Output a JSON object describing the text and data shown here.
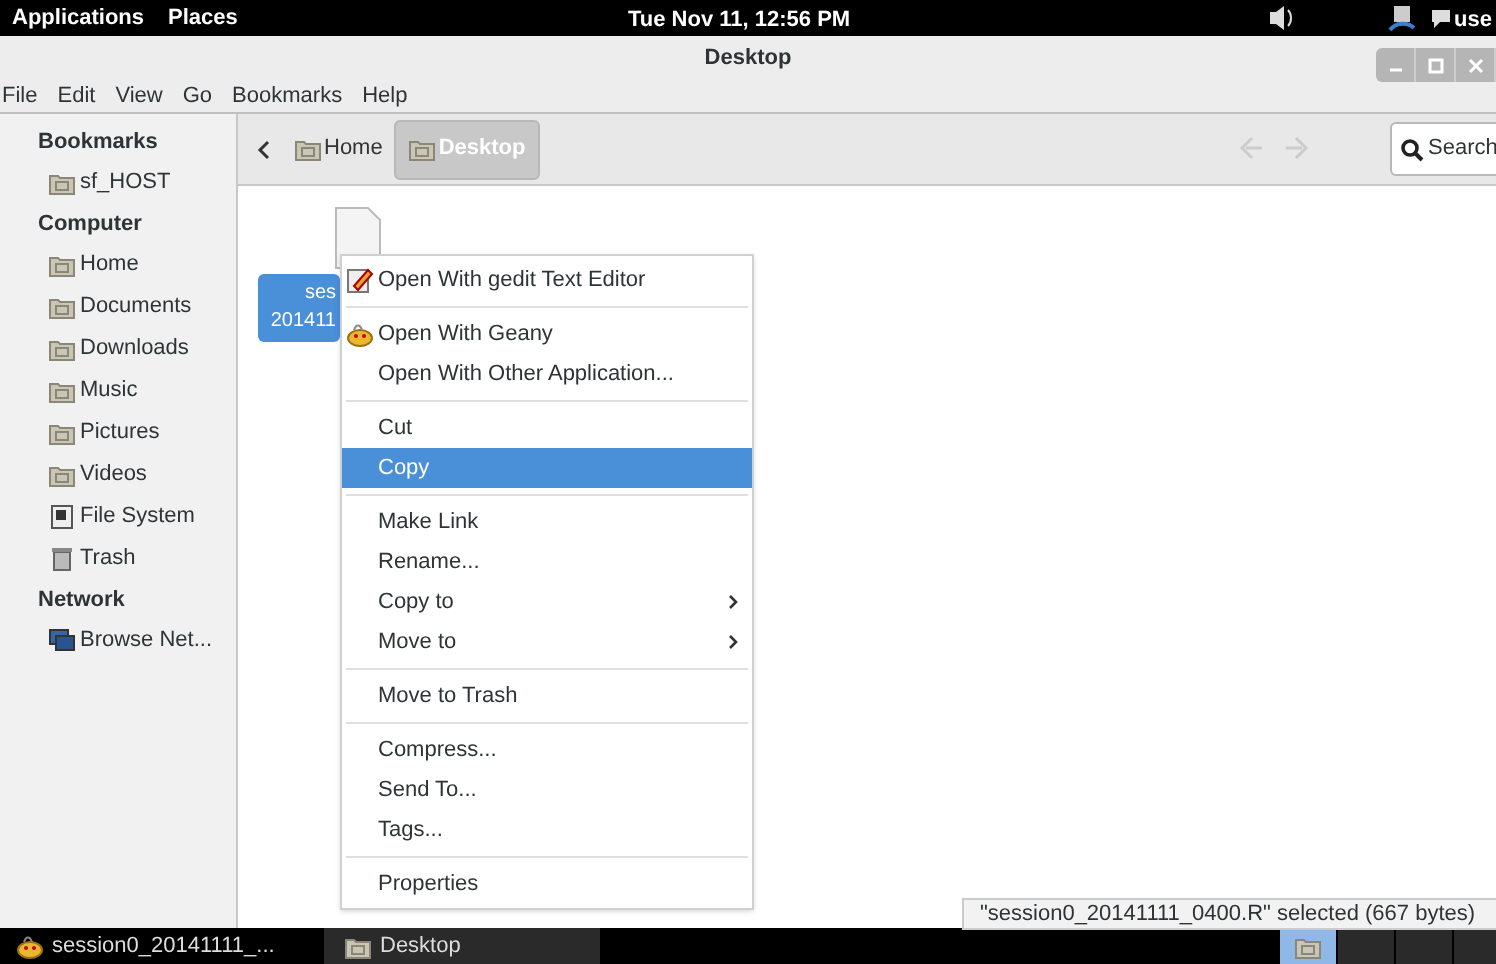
{
  "top_bar": {
    "menus": [
      "Applications",
      "Places"
    ],
    "clock": "Tue Nov 11, 12:56 PM",
    "user": "use"
  },
  "window": {
    "title": "Desktop"
  },
  "menu_bar": [
    "File",
    "Edit",
    "View",
    "Go",
    "Bookmarks",
    "Help"
  ],
  "sidebar": [
    {
      "heading": "Bookmarks",
      "items": [
        {
          "label": "sf_HOST",
          "kind": "folder"
        }
      ]
    },
    {
      "heading": "Computer",
      "items": [
        {
          "label": "Home",
          "kind": "folder"
        },
        {
          "label": "Documents",
          "kind": "folder"
        },
        {
          "label": "Downloads",
          "kind": "folder"
        },
        {
          "label": "Music",
          "kind": "folder"
        },
        {
          "label": "Pictures",
          "kind": "folder"
        },
        {
          "label": "Videos",
          "kind": "folder"
        },
        {
          "label": "File System",
          "kind": "drive"
        },
        {
          "label": "Trash",
          "kind": "trash"
        }
      ]
    },
    {
      "heading": "Network",
      "items": [
        {
          "label": "Browse Net...",
          "kind": "network"
        }
      ]
    }
  ],
  "path_bar": [
    {
      "label": "Home",
      "selected": false
    },
    {
      "label": "Desktop",
      "selected": true
    }
  ],
  "search": {
    "label": "Search"
  },
  "file": {
    "name_lines": [
      "ses",
      "201411"
    ],
    "selected": true
  },
  "context_menu": [
    {
      "kind": "item",
      "label": "Open With gedit Text Editor",
      "selected": false,
      "submenu": false
    },
    {
      "kind": "separator"
    },
    {
      "kind": "item",
      "label": "Open With Geany",
      "selected": false,
      "submenu": false
    },
    {
      "kind": "item",
      "label": "Open With Other Application...",
      "selected": false,
      "submenu": false
    },
    {
      "kind": "separator"
    },
    {
      "kind": "item",
      "label": "Cut",
      "selected": false,
      "submenu": false
    },
    {
      "kind": "item",
      "label": "Copy",
      "selected": true,
      "submenu": false
    },
    {
      "kind": "separator"
    },
    {
      "kind": "item",
      "label": "Make Link",
      "selected": false,
      "submenu": false
    },
    {
      "kind": "item",
      "label": "Rename...",
      "selected": false,
      "submenu": false
    },
    {
      "kind": "item",
      "label": "Copy to",
      "selected": false,
      "submenu": true
    },
    {
      "kind": "item",
      "label": "Move to",
      "selected": false,
      "submenu": true
    },
    {
      "kind": "separator"
    },
    {
      "kind": "item",
      "label": "Move to Trash",
      "selected": false,
      "submenu": false
    },
    {
      "kind": "separator"
    },
    {
      "kind": "item",
      "label": "Compress...",
      "selected": false,
      "submenu": false
    },
    {
      "kind": "item",
      "label": "Send To...",
      "selected": false,
      "submenu": false
    },
    {
      "kind": "item",
      "label": "Tags...",
      "selected": false,
      "submenu": false
    },
    {
      "kind": "separator"
    },
    {
      "kind": "item",
      "label": "Properties",
      "selected": false,
      "submenu": false
    }
  ],
  "status": "\"session0_20141111_0400.R\" selected (667 bytes)",
  "taskbar": {
    "tasks": [
      {
        "label": "session0_20141111_..."
      },
      {
        "label": "Desktop"
      }
    ],
    "workspaces": [
      {
        "selected": true
      },
      {
        "selected": false
      },
      {
        "selected": false
      },
      {
        "selected": false
      }
    ]
  }
}
